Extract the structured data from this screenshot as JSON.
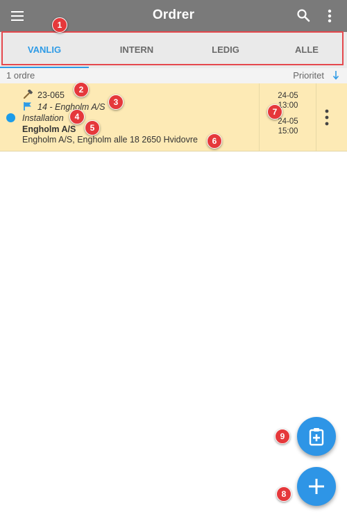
{
  "appbar": {
    "title": "Ordrer",
    "menu_icon": "hamburger-menu-icon",
    "search_icon": "search-icon",
    "more_icon": "more-vertical-icon",
    "background": "#7a7a7a"
  },
  "tabs": {
    "items": [
      {
        "label": "VANLIG",
        "active": true
      },
      {
        "label": "INTERN",
        "active": false
      },
      {
        "label": "LEDIG",
        "active": false
      },
      {
        "label": "ALLE",
        "active": false
      }
    ],
    "active_color": "#2e9be6"
  },
  "list_header": {
    "count": "1 ordre",
    "sort_label": "Prioritet",
    "sort_icon": "arrow-down-icon"
  },
  "orders": [
    {
      "number": "23-065",
      "project": "14 - Engholm A/S",
      "type": "Installation",
      "customer": "Engholm A/S",
      "address": "Engholm A/S, Engholm alle 18 2650 Hvidovre",
      "start_date": "24-05",
      "start_time": "13:00",
      "end_date": "24-05",
      "end_time": "15:00",
      "status_color": "#1c9ce9",
      "row_color": "#fdeab5"
    }
  ],
  "fabs": {
    "new_from_template_icon": "clipboard-plus-icon",
    "add_icon": "plus-icon",
    "color": "#2e95e6"
  },
  "annotations": {
    "b1": "1",
    "b2": "2",
    "b3": "3",
    "b4": "4",
    "b5": "5",
    "b6": "6",
    "b7": "7",
    "b8": "8",
    "b9": "9"
  }
}
